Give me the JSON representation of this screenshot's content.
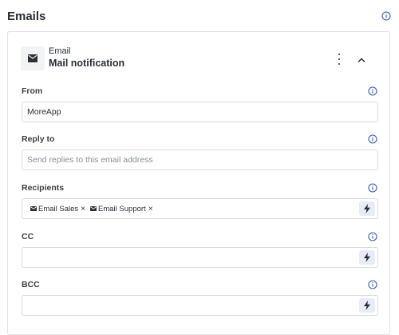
{
  "header": {
    "title": "Emails",
    "info_icon": "info-circle-icon"
  },
  "card": {
    "icon": "envelope-icon",
    "type_label": "Email",
    "name": "Mail notification",
    "menu_icon": "more-vertical-icon",
    "collapse_icon": "chevron-up-icon"
  },
  "fields": {
    "from": {
      "label": "From",
      "value": "MoreApp"
    },
    "reply_to": {
      "label": "Reply to",
      "placeholder": "Send replies to this email address"
    },
    "recipients": {
      "label": "Recipients",
      "chips": [
        {
          "label": "Email Sales"
        },
        {
          "label": "Email Support"
        }
      ]
    },
    "cc": {
      "label": "CC"
    },
    "bcc": {
      "label": "BCC"
    }
  },
  "colors": {
    "accent_bg": "#e6edf8",
    "info_icon": "#3b5ba9",
    "border": "#d7dbe0"
  }
}
